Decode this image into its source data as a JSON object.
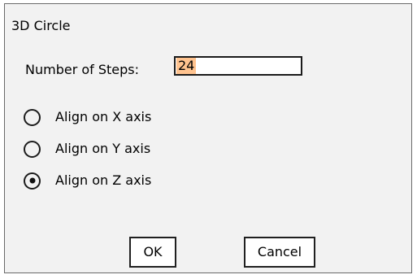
{
  "dialog": {
    "title": "3D Circle",
    "steps_label": "Number of Steps:",
    "steps_value": "24",
    "radio_options": [
      {
        "label": "Align on X axis",
        "selected": false
      },
      {
        "label": "Align on Y axis",
        "selected": false
      },
      {
        "label": "Align on Z axis",
        "selected": true
      }
    ],
    "buttons": {
      "ok": "OK",
      "cancel": "Cancel"
    }
  },
  "colors": {
    "dialog_background": "#f2f2f2",
    "selection_highlight": "#ffc38f",
    "border": "#202020"
  }
}
